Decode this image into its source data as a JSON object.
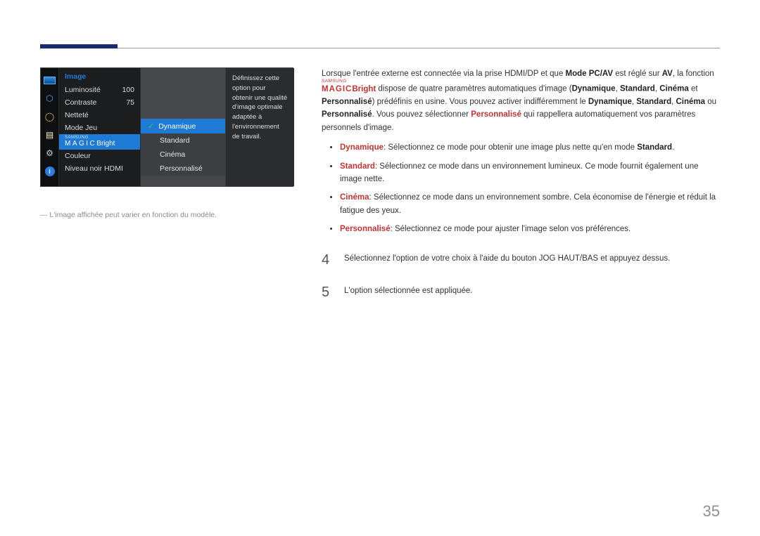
{
  "osd": {
    "title": "Image",
    "menu": [
      {
        "label": "Luminosité",
        "value": "100"
      },
      {
        "label": "Contraste",
        "value": "75"
      },
      {
        "label": "Netteté",
        "value": ""
      },
      {
        "label": "Mode Jeu",
        "value": ""
      },
      {
        "label_html": "magic",
        "value": ""
      },
      {
        "label": "Couleur",
        "value": ""
      },
      {
        "label": "Niveau noir HDMI",
        "value": ""
      }
    ],
    "magic_top": "SAMSUNG",
    "magic_word": "MAGIC",
    "magic_suffix": "Bright",
    "sub": {
      "items": [
        "Dynamique",
        "Standard",
        "Cinéma",
        "Personnalisé"
      ],
      "selected_index": 0
    },
    "tip": "Définissez cette option pour obtenir une qualité d'image optimale adaptée à l'environnement de travail."
  },
  "caption": "L'image affichée peut varier en fonction du modèle.",
  "intro": {
    "t1a": "Lorsque l'entrée externe est connectée via la prise HDMI/DP et que ",
    "t1b": "Mode PC/AV",
    "t1c": " est réglé sur ",
    "t1d": "AV",
    "t1e": ", la fonction ",
    "t2a": "dispose de quatre paramètres automatiques d'image (",
    "t2b": "Dynamique",
    "t2c": ", ",
    "t2d": "Standard",
    "t2e": ", ",
    "t2f": "Cinéma",
    "t2g": " et ",
    "t2h": "Personnalisé",
    "t2i": ") prédéfinis en",
    "t3a": "usine. Vous pouvez activer indifféremment le ",
    "t3b": "Dynamique",
    "t3c": ", ",
    "t3d": "Standard",
    "t3e": ", ",
    "t3f": "Cinéma",
    "t3g": " ou ",
    "t3h": "Personnalisé",
    "t3i": ". Vous pouvez sélectionner",
    "t4a": "Personnalisé",
    "t4b": " qui rappellera automatiquement vos paramètres personnels d'image."
  },
  "modes": {
    "dyn_l": "Dynamique",
    "dyn_t1": ": Sélectionnez ce mode pour obtenir une image plus nette qu'en mode ",
    "dyn_t2": "Standard",
    "dyn_t3": ".",
    "std_l": "Standard",
    "std_t": ": Sélectionnez ce mode dans un environnement lumineux. Ce mode fournit également une image nette.",
    "cin_l": "Cinéma",
    "cin_t": ": Sélectionnez ce mode dans un environnement sombre. Cela économise de l'énergie et réduit la fatigue des yeux.",
    "per_l": "Personnalisé",
    "per_t": ": Sélectionnez ce mode pour ajuster l'image selon vos préférences."
  },
  "steps": {
    "s4n": "4",
    "s4t": "Sélectionnez l'option de votre choix à l'aide du bouton JOG HAUT/BAS et appuyez dessus.",
    "s5n": "5",
    "s5t": "L'option sélectionnée est appliquée."
  },
  "page_number": "35",
  "smagic_top": "SAMSUNG",
  "smagic_word": "MAGIC",
  "smagic_suffix": "Bright"
}
